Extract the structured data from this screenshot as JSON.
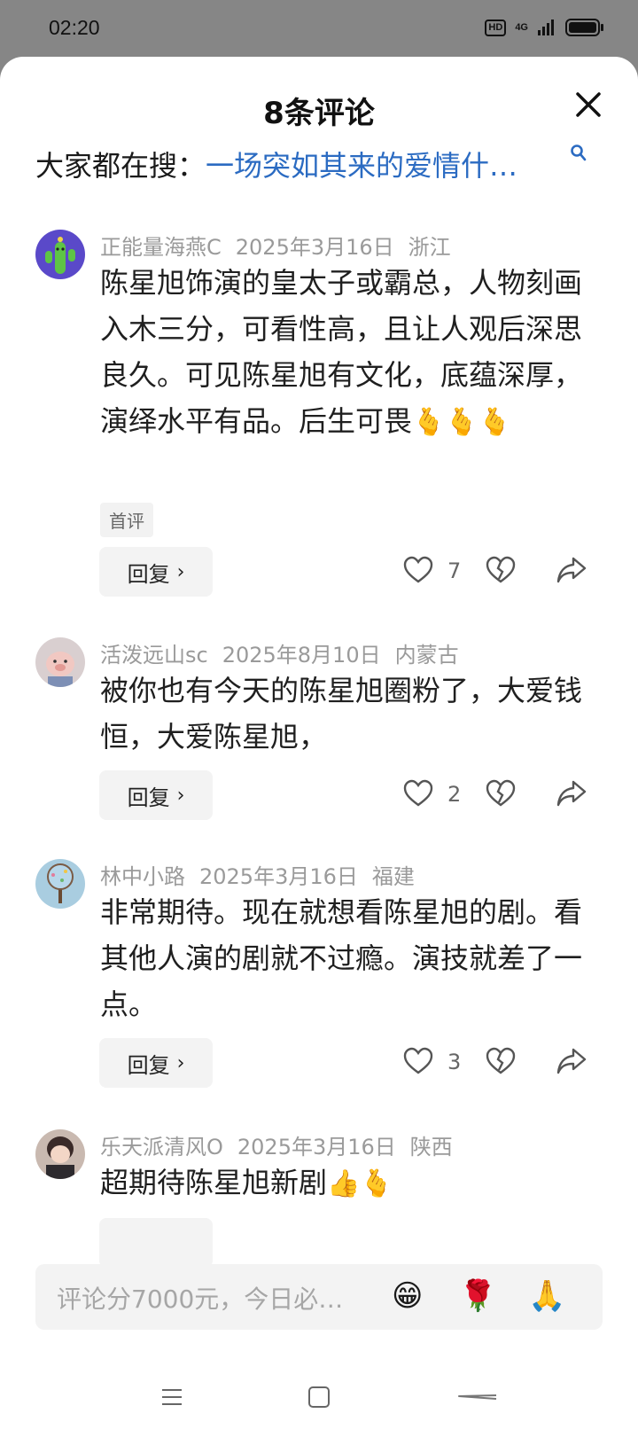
{
  "status_bar": {
    "time": "02:20",
    "hd": "HD",
    "network": "4G"
  },
  "sheet": {
    "title": "8条评论"
  },
  "hot_search": {
    "prefix": "大家都在搜：",
    "query": "一场突如其来的爱情什…"
  },
  "comments": [
    {
      "user": "正能量海燕C",
      "date": "2025年3月16日",
      "location": "浙江",
      "text": "陈星旭饰演的皇太子或霸总，人物刻画入木三分，可看性高，且让人观后深思良久。可见陈星旭有文化，底蕴深厚，演绎水平有品。后生可畏",
      "emojis": "🫰🫰🫰",
      "tag": "首评",
      "reply_label": "回复",
      "likes": "7"
    },
    {
      "user": "活泼远山sc",
      "date": "2025年8月10日",
      "location": "内蒙古",
      "text": "被你也有今天的陈星旭圈粉了，大爱钱恒，大爱陈星旭，",
      "emojis": "",
      "reply_label": "回复",
      "likes": "2"
    },
    {
      "user": "林中小路",
      "date": "2025年3月16日",
      "location": "福建",
      "text": "非常期待。现在就想看陈星旭的剧。看其他人演的剧就不过瘾。演技就差了一点。",
      "emojis": "",
      "reply_label": "回复",
      "likes": "3"
    },
    {
      "user": "乐天派清风O",
      "date": "2025年3月16日",
      "location": "陕西",
      "text": "超期待陈星旭新剧",
      "emojis": "👍🫰"
    }
  ],
  "input": {
    "placeholder": "评论分7000元，今日必…",
    "quick_emojis": [
      "😁",
      "🌹",
      "🙏"
    ]
  },
  "colors": {
    "link": "#2b6bc2",
    "meta": "#9a9a9a",
    "background": "#ffffff"
  }
}
